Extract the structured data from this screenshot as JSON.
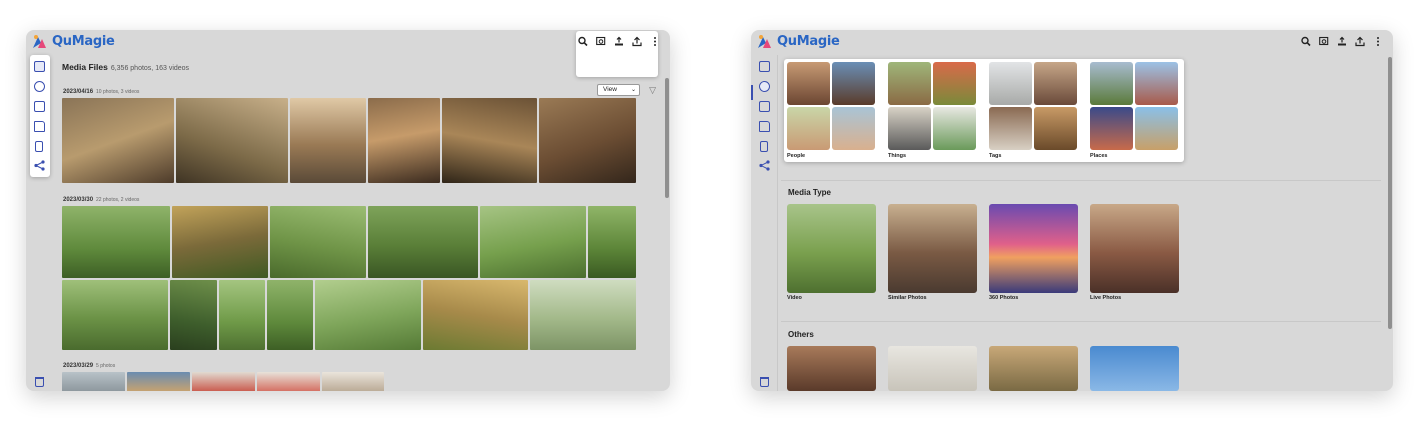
{
  "app": {
    "name": "QuMagie"
  },
  "colors": {
    "accent": "#3a4fb0",
    "brand": "#2a66c4",
    "panel_bg": "#d8d8d8"
  },
  "toolbar": {
    "icons": [
      "search-icon",
      "image-search-icon",
      "upload-stack-icon",
      "upload-icon",
      "more-vertical-icon"
    ]
  },
  "sidebar": {
    "icons": [
      "media-icon",
      "search-icon",
      "album-icon",
      "folder-icon",
      "phone-icon",
      "share-icon",
      "trash-icon"
    ]
  },
  "left": {
    "title": "Media Files",
    "summary": "6,356 photos, 163 videos",
    "view_label": "View",
    "groups": [
      {
        "date": "2023/04/16",
        "count": "10 photos, 3 videos"
      },
      {
        "date": "2023/03/30",
        "count": "22 photos, 2 videos"
      },
      {
        "date": "2023/03/29",
        "count": "5 photos"
      }
    ]
  },
  "right": {
    "categories": [
      {
        "label": "People"
      },
      {
        "label": "Things"
      },
      {
        "label": "Tags"
      },
      {
        "label": "Places"
      }
    ],
    "media_type_title": "Media Type",
    "media_types": [
      {
        "label": "Video"
      },
      {
        "label": "Similar Photos"
      },
      {
        "label": "360 Photos"
      },
      {
        "label": "Live Photos"
      }
    ],
    "others_title": "Others"
  }
}
